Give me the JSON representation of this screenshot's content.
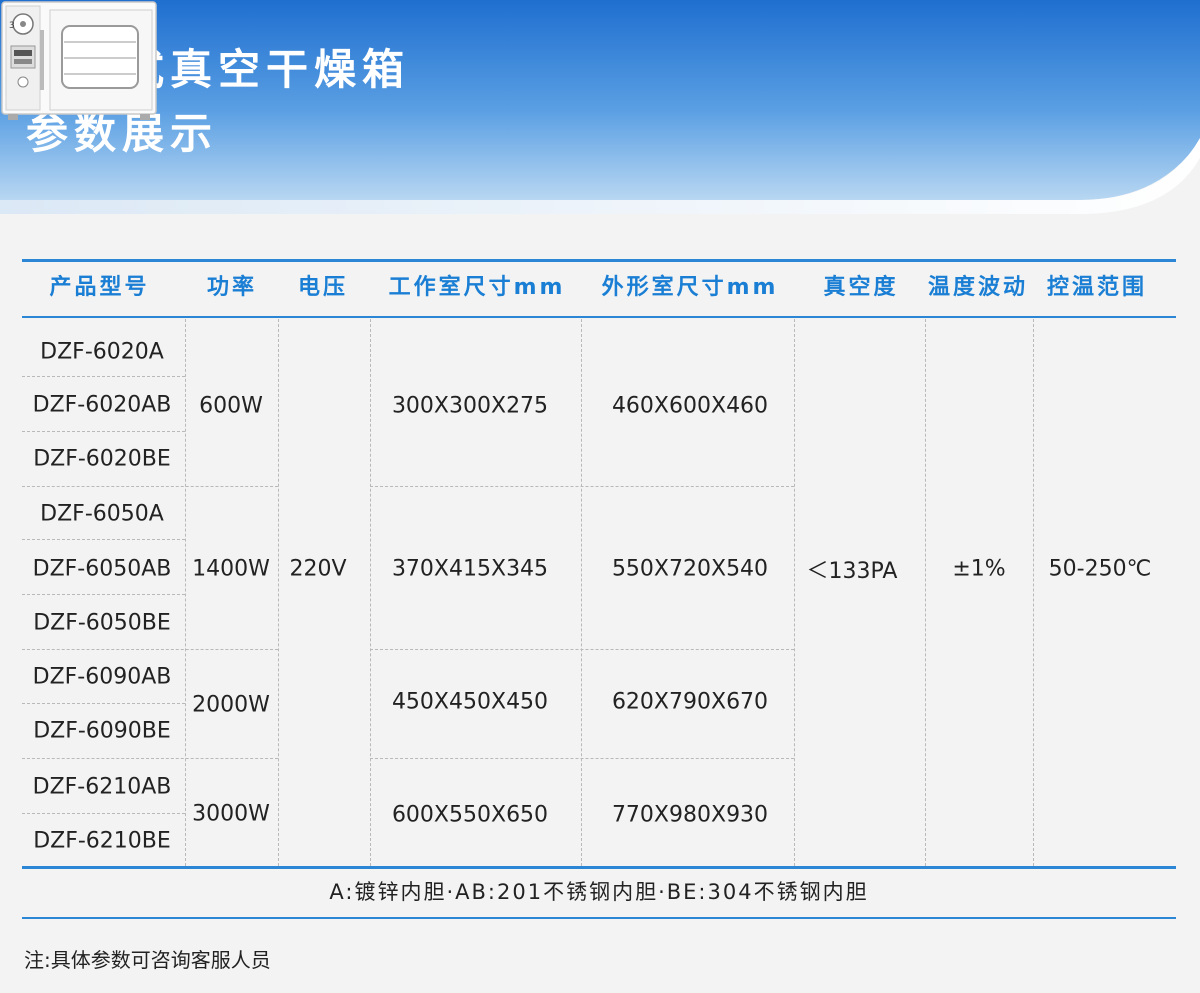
{
  "header": {
    "title_line1": "分体式真空干燥箱",
    "title_line2": "参数展示",
    "product_image": "vacuum-drying-oven"
  },
  "colors": {
    "accent": "#2b86d6",
    "header_text": "#1a7fd4",
    "banner_top": "#1f6fd0",
    "banner_bottom": "#9cc6ee",
    "background": "#f3f3f3"
  },
  "table": {
    "headers": [
      "产品型号",
      "功率",
      "电压",
      "工作室尺寸mm",
      "外形室尺寸mm",
      "真空度",
      "温度波动",
      "控温范围"
    ],
    "models": [
      "DZF-6020A",
      "DZF-6020AB",
      "DZF-6020BE",
      "DZF-6050A",
      "DZF-6050AB",
      "DZF-6050BE",
      "DZF-6090AB",
      "DZF-6090BE",
      "DZF-6210AB",
      "DZF-6210BE"
    ],
    "groups": [
      {
        "power": "600W",
        "work_size": "300X300X275",
        "outer_size": "460X600X460"
      },
      {
        "power": "1400W",
        "work_size": "370X415X345",
        "outer_size": "550X720X540"
      },
      {
        "power": "2000W",
        "work_size": "450X450X450",
        "outer_size": "620X790X670"
      },
      {
        "power": "3000W",
        "work_size": "600X550X650",
        "outer_size": "770X980X930"
      }
    ],
    "voltage": "220V",
    "vacuum": "＜133PA",
    "temp_fluctuation": "±1%",
    "temp_range": "50-250℃"
  },
  "legend": "A:镀锌内胆·AB:201不锈钢内胆·BE:304不锈钢内胆",
  "note": "注:具体参数可咨询客服人员"
}
